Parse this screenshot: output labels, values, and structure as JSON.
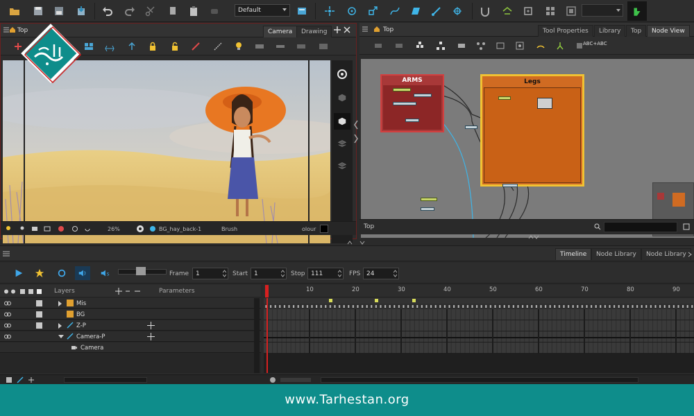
{
  "layout_preset": "Default",
  "camera_panel": {
    "title": "Top",
    "tabs": [
      "Camera",
      "Drawing"
    ],
    "active_tab": "Camera",
    "status": {
      "zoom": "26%",
      "drawing": "BG_hay_back-1",
      "tool": "Brush",
      "colour": "olour"
    }
  },
  "node_panel": {
    "title": "Top",
    "tabs": [
      "Tool Properties",
      "Library",
      "Top",
      "Node View"
    ],
    "active_tab": "Node View",
    "footer": "Top",
    "groups": [
      {
        "name": "ARMS",
        "color": "#a83838"
      },
      {
        "name": "Legs",
        "color": "#d06b22"
      }
    ],
    "toolbar_text": "ABC+ABC"
  },
  "timeline": {
    "tabs": [
      "Timeline",
      "Node Library",
      "Node Library"
    ],
    "active_tab": "Timeline",
    "frame_label": "Frame",
    "frame_value": "1",
    "start_label": "Start",
    "start_value": "1",
    "stop_label": "Stop",
    "stop_value": "111",
    "fps_label": "FPS",
    "fps_value": "24",
    "layers_header": "Layers",
    "parameters_header": "Parameters",
    "layers": [
      {
        "name": "Mis",
        "type": "group"
      },
      {
        "name": "BG",
        "type": "drawing"
      },
      {
        "name": "Z-P",
        "type": "peg"
      },
      {
        "name": "Camera-P",
        "type": "peg"
      },
      {
        "name": "Camera",
        "type": "camera"
      }
    ],
    "ruler": [
      "10",
      "20",
      "30",
      "40",
      "50",
      "60",
      "70",
      "80",
      "90"
    ]
  },
  "footer": {
    "url": "www.Tarhestan.org",
    "color": "#0e8d8b"
  },
  "logo": {
    "text": "طرحستان"
  }
}
